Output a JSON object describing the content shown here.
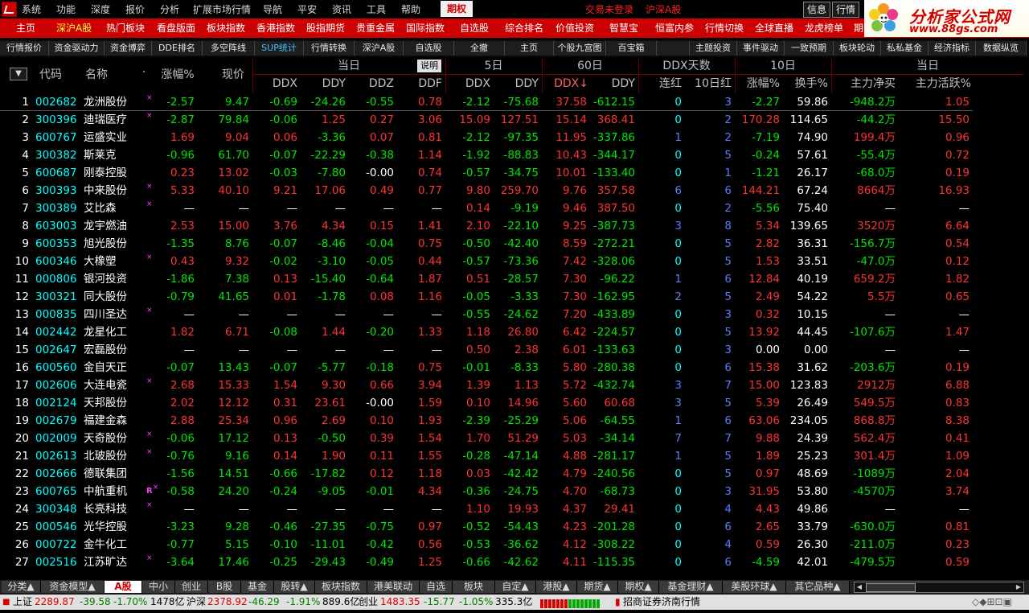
{
  "menubar": {
    "items": [
      "系统",
      "功能",
      "深度",
      "报价",
      "分析",
      "扩展市场行情",
      "导航",
      "平安",
      "资讯",
      "工具",
      "帮助"
    ],
    "active": "期权",
    "status_trade": "交易未登录",
    "status_market": "沪深A股",
    "btn_info": "信息",
    "btn_quote": "行情"
  },
  "brand": {
    "title": "分析家公式网",
    "url": "www.88gs.com"
  },
  "redbar": {
    "items": [
      "主页",
      "深沪A股",
      "热门板块",
      "看盘版面",
      "板块指数",
      "香港指数",
      "股指期货",
      "贵重金属",
      "国际指数",
      "自选股",
      "综合排名",
      "价值投资",
      "智慧宝",
      "恒富内参",
      "行情切换",
      "全球直播",
      "龙虎榜单",
      "期"
    ],
    "active_index": 1
  },
  "subbar": {
    "items": [
      "行情报价",
      "资金驱动力",
      "资金博弈",
      "DDE排名",
      "多空阵线",
      "SUP统计",
      "行情转换",
      "深沪A股",
      "自选股",
      "全撤",
      "主页",
      "个股九宫图",
      "百宝箱",
      "",
      "主题投资",
      "事件驱动",
      "一致预期",
      "板块轮动",
      "私私基金",
      "经济指标",
      "数据纵览"
    ],
    "active_index": 5
  },
  "table": {
    "sort_btn": "▼",
    "desc_btn": "说明",
    "headers": {
      "code": "代码",
      "name": "名称",
      "dot": "·",
      "pct": "涨幅%",
      "price": "现价",
      "g_today": "当日",
      "g_5d": "5日",
      "g_60d": "60日",
      "g_ddxdays": "DDX天数",
      "g_10d": "10日",
      "g_today2": "当日",
      "ddx": "DDX",
      "ddy": "DDY",
      "ddz": "DDZ",
      "ddf": "DDF",
      "ddx5": "DDX",
      "ddy5": "DDY",
      "ddx60": "DDX↓",
      "ddy60": "DDY",
      "lianhong": "连红",
      "shirihong": "10日红",
      "pct10": "涨幅%",
      "turnover": "换手%",
      "netbuy": "主力净买",
      "active": "主力活跃%"
    },
    "rows": [
      [
        "1",
        "002682",
        "龙洲股份",
        "×",
        "-2.57",
        "9.47",
        "-0.69",
        "-24.26",
        "-0.55",
        "0.78",
        "-2.12",
        "-75.68",
        "37.58",
        "-612.15",
        "0",
        "3",
        "-2.27",
        "59.86",
        "-948.2万",
        "1.05"
      ],
      [
        "2",
        "300396",
        "迪瑞医疗",
        "×",
        "-2.87",
        "79.84",
        "-0.06",
        "1.25",
        "0.27",
        "3.06",
        "15.09",
        "127.51",
        "15.14",
        "368.41",
        "0",
        "2",
        "170.28",
        "114.65",
        "-44.2万",
        "15.50"
      ],
      [
        "3",
        "600767",
        "运盛实业",
        "",
        "1.69",
        "9.04",
        "0.06",
        "-3.36",
        "0.07",
        "0.81",
        "-2.12",
        "-97.35",
        "11.95",
        "-337.86",
        "1",
        "2",
        "-7.19",
        "74.90",
        "199.4万",
        "0.96"
      ],
      [
        "4",
        "300382",
        "斯莱克",
        "",
        "-0.96",
        "61.70",
        "-0.07",
        "-22.29",
        "-0.38",
        "1.14",
        "-1.92",
        "-88.83",
        "10.43",
        "-344.17",
        "0",
        "5",
        "-0.24",
        "57.61",
        "-55.4万",
        "0.72"
      ],
      [
        "5",
        "600687",
        "刚泰控股",
        "",
        "0.23",
        "13.02",
        "-0.03",
        "-7.80",
        "-0.00",
        "0.74",
        "-0.57",
        "-34.75",
        "10.01",
        "-133.40",
        "0",
        "1",
        "-1.21",
        "26.17",
        "-68.0万",
        "0.19"
      ],
      [
        "6",
        "300393",
        "中来股份",
        "×",
        "5.33",
        "40.10",
        "9.21",
        "17.06",
        "0.49",
        "0.77",
        "9.80",
        "259.70",
        "9.76",
        "357.58",
        "6",
        "6",
        "144.21",
        "67.24",
        "8664万",
        "16.93"
      ],
      [
        "7",
        "300389",
        "艾比森",
        "×",
        "—",
        "—",
        "—",
        "—",
        "—",
        "—",
        "0.14",
        "-9.19",
        "9.46",
        "387.50",
        "0",
        "2",
        "-5.56",
        "75.40",
        "—",
        "—"
      ],
      [
        "8",
        "603003",
        "龙宇燃油",
        "",
        "2.53",
        "15.00",
        "3.76",
        "4.34",
        "0.15",
        "1.41",
        "2.10",
        "-22.10",
        "9.25",
        "-387.73",
        "3",
        "8",
        "5.34",
        "139.65",
        "3520万",
        "6.64"
      ],
      [
        "9",
        "600353",
        "旭光股份",
        "",
        "-1.35",
        "8.76",
        "-0.07",
        "-8.46",
        "-0.04",
        "0.75",
        "-0.50",
        "-42.40",
        "8.59",
        "-272.21",
        "0",
        "5",
        "2.82",
        "36.31",
        "-156.7万",
        "0.54"
      ],
      [
        "10",
        "600346",
        "大橡塑",
        "×",
        "0.43",
        "9.32",
        "-0.02",
        "-3.10",
        "-0.05",
        "0.44",
        "-0.57",
        "-73.36",
        "7.42",
        "-328.06",
        "0",
        "5",
        "1.53",
        "33.51",
        "-47.0万",
        "0.12"
      ],
      [
        "11",
        "000806",
        "银河投资",
        "",
        "-1.86",
        "7.38",
        "0.13",
        "-15.40",
        "-0.64",
        "1.87",
        "0.51",
        "-28.57",
        "7.30",
        "-96.22",
        "1",
        "6",
        "12.84",
        "40.19",
        "659.2万",
        "1.82"
      ],
      [
        "12",
        "300321",
        "同大股份",
        "",
        "-0.79",
        "41.65",
        "0.01",
        "-1.78",
        "0.08",
        "1.16",
        "-0.05",
        "-3.33",
        "7.30",
        "-162.95",
        "2",
        "5",
        "2.49",
        "54.22",
        "5.5万",
        "0.65"
      ],
      [
        "13",
        "000835",
        "四川圣达",
        "×",
        "—",
        "—",
        "—",
        "—",
        "—",
        "—",
        "-0.55",
        "-24.62",
        "7.20",
        "-433.89",
        "0",
        "3",
        "0.32",
        "10.15",
        "—",
        "—"
      ],
      [
        "14",
        "002442",
        "龙星化工",
        "",
        "1.82",
        "6.71",
        "-0.08",
        "1.44",
        "-0.20",
        "1.33",
        "1.18",
        "26.80",
        "6.42",
        "-224.57",
        "0",
        "5",
        "13.92",
        "44.45",
        "-107.6万",
        "1.47"
      ],
      [
        "15",
        "002647",
        "宏磊股份",
        "",
        "—",
        "—",
        "—",
        "—",
        "—",
        "—",
        "0.50",
        "2.38",
        "6.01",
        "-133.63",
        "0",
        "3",
        "0.00",
        "0.00",
        "—",
        "—"
      ],
      [
        "16",
        "600560",
        "金自天正",
        "",
        "-0.07",
        "13.43",
        "-0.07",
        "-5.77",
        "-0.18",
        "0.75",
        "-0.01",
        "-8.33",
        "5.80",
        "-280.38",
        "0",
        "6",
        "15.38",
        "31.62",
        "-203.6万",
        "0.19"
      ],
      [
        "17",
        "002606",
        "大连电瓷",
        "×",
        "2.68",
        "15.33",
        "1.54",
        "9.30",
        "0.66",
        "3.94",
        "1.39",
        "1.13",
        "5.72",
        "-432.74",
        "3",
        "7",
        "15.00",
        "123.83",
        "2912万",
        "6.88"
      ],
      [
        "18",
        "002124",
        "天邦股份",
        "",
        "2.02",
        "12.12",
        "0.31",
        "23.61",
        "-0.00",
        "1.59",
        "0.10",
        "14.96",
        "5.60",
        "60.68",
        "3",
        "5",
        "5.39",
        "26.49",
        "549.5万",
        "0.83"
      ],
      [
        "19",
        "002679",
        "福建金森",
        "",
        "2.88",
        "25.34",
        "0.96",
        "2.69",
        "0.10",
        "1.93",
        "-2.39",
        "-25.29",
        "5.06",
        "-64.55",
        "1",
        "6",
        "63.06",
        "234.05",
        "868.8万",
        "8.38"
      ],
      [
        "20",
        "002009",
        "天奇股份",
        "×",
        "-0.06",
        "17.12",
        "0.13",
        "-0.50",
        "0.39",
        "1.54",
        "1.70",
        "51.29",
        "5.03",
        "-34.14",
        "7",
        "7",
        "9.88",
        "24.39",
        "562.4万",
        "0.41"
      ],
      [
        "21",
        "002613",
        "北玻股份",
        "×",
        "-0.76",
        "9.16",
        "0.14",
        "1.90",
        "0.11",
        "1.55",
        "-0.28",
        "-47.14",
        "4.88",
        "-281.17",
        "1",
        "5",
        "1.89",
        "25.23",
        "301.4万",
        "1.09"
      ],
      [
        "22",
        "002666",
        "德联集团",
        "",
        "-1.56",
        "14.51",
        "-0.66",
        "-17.82",
        "0.12",
        "1.18",
        "0.03",
        "-42.42",
        "4.79",
        "-240.56",
        "0",
        "5",
        "0.97",
        "48.69",
        "-1089万",
        "2.04"
      ],
      [
        "23",
        "600765",
        "中航重机",
        "R×",
        "-0.58",
        "24.20",
        "-0.24",
        "-9.05",
        "-0.01",
        "4.34",
        "-0.36",
        "-24.75",
        "4.70",
        "-68.73",
        "0",
        "3",
        "31.95",
        "53.80",
        "-4570万",
        "3.74"
      ],
      [
        "24",
        "300348",
        "长亮科技",
        "×",
        "—",
        "—",
        "—",
        "—",
        "—",
        "—",
        "1.10",
        "19.93",
        "4.37",
        "29.41",
        "0",
        "4",
        "4.43",
        "49.86",
        "—",
        "—"
      ],
      [
        "25",
        "000546",
        "光华控股",
        "",
        "-3.23",
        "9.28",
        "-0.46",
        "-27.35",
        "-0.75",
        "0.97",
        "-0.52",
        "-54.43",
        "4.23",
        "-201.28",
        "0",
        "6",
        "2.65",
        "33.79",
        "-630.0万",
        "0.81"
      ],
      [
        "26",
        "000722",
        "金牛化工",
        "",
        "-0.77",
        "5.15",
        "-0.10",
        "-11.01",
        "-0.42",
        "0.56",
        "-0.53",
        "-36.62",
        "4.12",
        "-308.22",
        "0",
        "4",
        "0.59",
        "26.30",
        "-211.0万",
        "0.23"
      ],
      [
        "27",
        "002516",
        "江苏旷达",
        "×",
        "-3.64",
        "17.46",
        "-0.25",
        "-29.43",
        "-0.49",
        "1.25",
        "-0.66",
        "-42.62",
        "4.11",
        "-115.35",
        "0",
        "6",
        "-4.59",
        "42.01",
        "-479.5万",
        "0.59"
      ]
    ]
  },
  "tabs": {
    "items": [
      "分类▲",
      "资金模型▲",
      "A股",
      "中小",
      "创业",
      "B股",
      "基金",
      "股转▲",
      "板块指数",
      "港美联动",
      "自选",
      "板块",
      "自定▲",
      "港股▲",
      "期货▲",
      "期权▲",
      "基金理财▲",
      "美股环球▲",
      "其它品种▲"
    ],
    "active_index": 2
  },
  "status": {
    "sh_label": "上证",
    "sh_val": "2289.87",
    "sh_chg": "-39.58",
    "sh_pct": "-1.70%",
    "sh_amt": "1478亿",
    "sz_label": "沪深",
    "sz_val": "2378.92",
    "sz_chg": "-46.29",
    "sz_pct": "-1.91%",
    "sz_amt": "889.6亿",
    "cy_label": "创业",
    "cy_val": "1483.35",
    "cy_chg": "-15.77",
    "cy_pct": "-1.05%",
    "cy_amt": "335.3亿",
    "broker": "招商证券济南行情"
  },
  "colors": {
    "up": "#ff3232",
    "down": "#00e600",
    "accent": "#cc0000",
    "cyan": "#00ffff",
    "yellow": "#ffff00"
  }
}
